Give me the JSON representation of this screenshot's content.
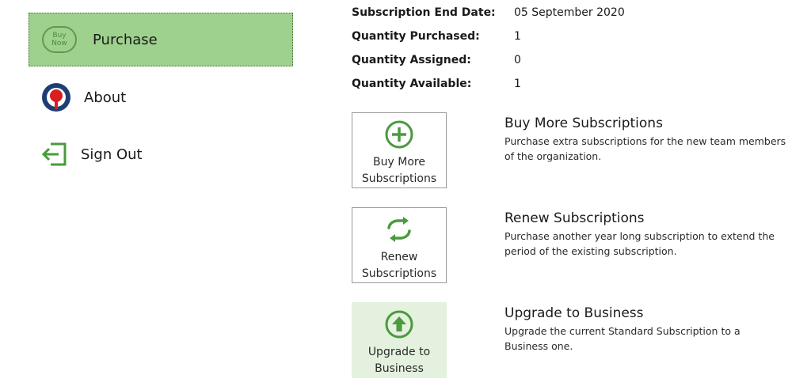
{
  "sidebar": {
    "items": [
      {
        "label": "Purchase",
        "icon": "buy-now-icon",
        "badge_line1": "Buy",
        "badge_line2": "Now",
        "active": true
      },
      {
        "label": "About",
        "icon": "about-icon",
        "active": false
      },
      {
        "label": "Sign Out",
        "icon": "sign-out-icon",
        "active": false
      }
    ]
  },
  "info": [
    {
      "label": "Subscription End Date:",
      "value": "05 September 2020"
    },
    {
      "label": "Quantity Purchased:",
      "value": "1"
    },
    {
      "label": "Quantity Assigned:",
      "value": "0"
    },
    {
      "label": "Quantity Available:",
      "value": "1"
    }
  ],
  "actions": [
    {
      "tile_line1": "Buy More",
      "tile_line2": "Subscriptions",
      "title": "Buy More Subscriptions",
      "description": "Purchase extra subscriptions for the new team members of the organization.",
      "icon": "plus-circle-icon"
    },
    {
      "tile_line1": "Renew",
      "tile_line2": "Subscriptions",
      "title": "Renew Subscriptions",
      "description": "Purchase another year long subscription to extend the period of the existing subscription.",
      "icon": "renew-icon"
    },
    {
      "tile_line1": "Upgrade to",
      "tile_line2": "Business",
      "title": "Upgrade to Business",
      "description": "Upgrade the current Standard Subscription to a Business one.",
      "icon": "upgrade-arrow-icon"
    }
  ],
  "colors": {
    "accent_green": "#4a9a3e",
    "active_bg": "#9fd18e",
    "highlight_tile_bg": "#e4f1df",
    "about_red": "#d81e1e",
    "about_blue": "#1d3e73"
  }
}
